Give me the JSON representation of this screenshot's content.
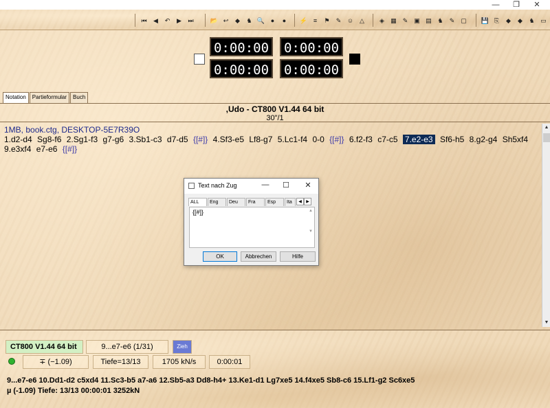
{
  "window": {
    "minimize": "—",
    "restore": "❐",
    "close": "✕"
  },
  "toolbar": {
    "group1": [
      "⏮",
      "◀",
      "↶",
      "▶",
      "⏭"
    ],
    "group2": [
      "📂",
      "↩",
      "◆",
      "♞",
      "🔍",
      "●",
      "●"
    ],
    "group3": [
      "⚡",
      "≡",
      "⚑",
      "✎",
      "☺",
      "△"
    ],
    "group4": [
      "◈",
      "▦",
      "✎",
      "▣",
      "▤",
      "♞",
      "✎",
      "▢"
    ],
    "group5": [
      "💾",
      "⎘",
      "◆",
      "◆",
      "♞",
      "▭"
    ]
  },
  "clocks": {
    "top_left": "0:00:00",
    "top_right": "0:00:00",
    "bottom_left": "0:00:00",
    "bottom_right": "0:00:00"
  },
  "tabs": [
    "Notation",
    "Partieformular",
    "Buch"
  ],
  "game": {
    "title": ",Udo - CT800 V1.44 64 bit",
    "time_control": "30\"/1"
  },
  "notation": {
    "meta": "1MB, book.ctg, DESKTOP-5E7R39O",
    "moves": [
      {
        "t": "1.d2-d4"
      },
      {
        "t": "Sg8-f6"
      },
      {
        "t": "2.Sg1-f3"
      },
      {
        "t": "g7-g6"
      },
      {
        "t": "3.Sb1-c3"
      },
      {
        "t": "d7-d5"
      },
      {
        "t": "{[#]}",
        "ann": true
      },
      {
        "t": "4.Sf3-e5"
      },
      {
        "t": "Lf8-g7"
      },
      {
        "t": "5.Lc1-f4"
      },
      {
        "t": "0-0"
      },
      {
        "t": "{[#]}",
        "ann": true
      },
      {
        "t": "6.f2-f3"
      },
      {
        "t": "c7-c5"
      },
      {
        "t": "7.e2-e3",
        "sel": true
      },
      {
        "t": "Sf6-h5"
      },
      {
        "t": "8.g2-g4"
      },
      {
        "t": "Sh5xf4"
      },
      {
        "t": "9.e3xf4"
      },
      {
        "t": "e7-e6"
      },
      {
        "t": "{[#]}",
        "ann": true
      }
    ]
  },
  "dialog": {
    "title": "Text nach Zug",
    "tabs": [
      "ALL",
      "Eng",
      "Deu",
      "Fra",
      "Esp",
      "Ita"
    ],
    "text": "{[#]}",
    "ok": "OK",
    "cancel": "Abbrechen",
    "help": "Hilfe"
  },
  "engine": {
    "name": "CT800 V1.44 64 bit",
    "current_move": "9...e7-e6 (1/31)",
    "zieh": "Zieh",
    "eval": "∓ (−1.09)",
    "depth": "Tiefe=13/13",
    "speed": "1705 kN/s",
    "time": "0:00:01",
    "pv_line1": "9...e7-e6 10.Dd1-d2 c5xd4 11.Sc3-b5 a7-a6 12.Sb5-a3 Dd8-h4+ 13.Ke1-d1 Lg7xe5 14.f4xe5 Sb8-c6 15.Lf1-g2 Sc6xe5",
    "pv_line2": "µ  (-1.09)   Tiefe: 13/13   00:00:01  3252kN"
  }
}
